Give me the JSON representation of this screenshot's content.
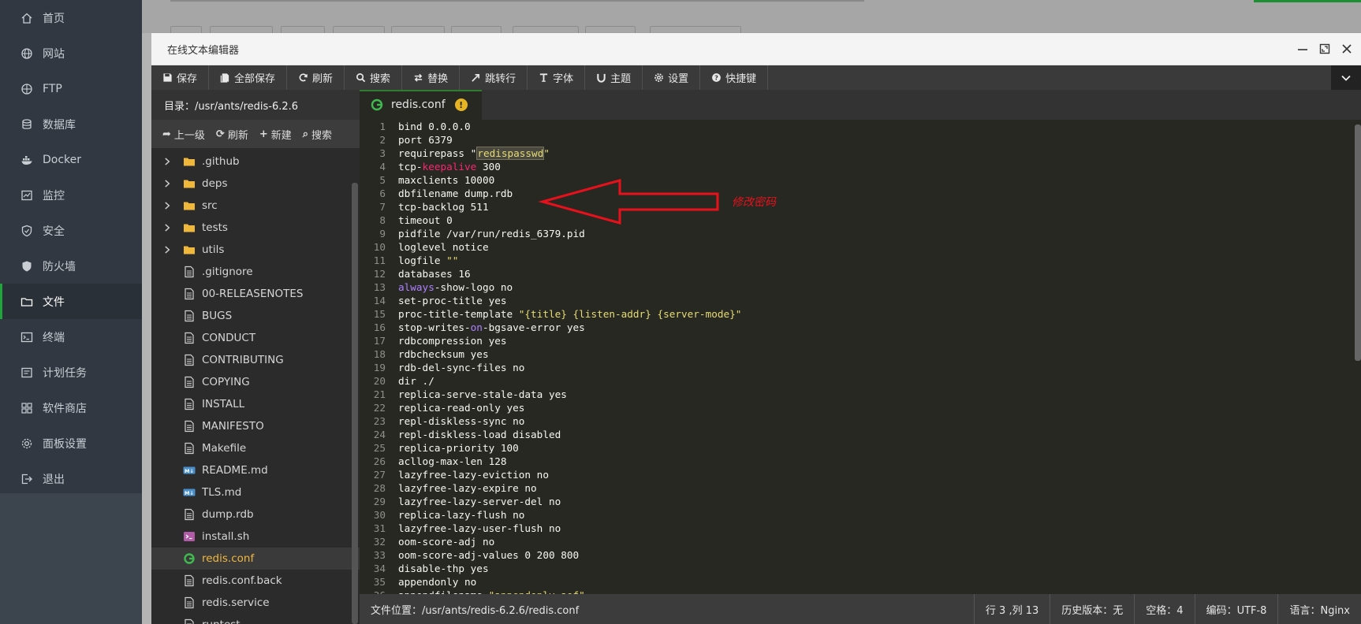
{
  "nav": {
    "items": [
      {
        "label": "首页",
        "icon": "home-icon"
      },
      {
        "label": "网站",
        "icon": "globe-icon"
      },
      {
        "label": "FTP",
        "icon": "ftp-globe-icon"
      },
      {
        "label": "数据库",
        "icon": "database-icon"
      },
      {
        "label": "Docker",
        "icon": "docker-icon"
      },
      {
        "label": "监控",
        "icon": "monitor-icon"
      },
      {
        "label": "安全",
        "icon": "shield-icon"
      },
      {
        "label": "防火墙",
        "icon": "firewall-icon"
      },
      {
        "label": "文件",
        "icon": "folder-icon"
      },
      {
        "label": "终端",
        "icon": "terminal-icon"
      },
      {
        "label": "计划任务",
        "icon": "clock-icon"
      },
      {
        "label": "软件商店",
        "icon": "apps-icon"
      },
      {
        "label": "面板设置",
        "icon": "gear-icon"
      },
      {
        "label": "退出",
        "icon": "logout-icon"
      }
    ],
    "active_index": 8
  },
  "editor": {
    "title": "在线文本编辑器",
    "toolbar": [
      {
        "label": "保存",
        "icon": "save-icon"
      },
      {
        "label": "全部保存",
        "icon": "save-all-icon"
      },
      {
        "label": "刷新",
        "icon": "refresh-icon"
      },
      {
        "label": "搜索",
        "icon": "search-icon"
      },
      {
        "label": "替换",
        "icon": "replace-icon"
      },
      {
        "label": "跳转行",
        "icon": "jump-icon"
      },
      {
        "label": "字体",
        "icon": "font-icon"
      },
      {
        "label": "主题",
        "icon": "theme-icon"
      },
      {
        "label": "设置",
        "icon": "gear-icon"
      },
      {
        "label": "快捷键",
        "icon": "help-icon"
      }
    ]
  },
  "files": {
    "directory": "目录：/usr/ants/redis-6.2.6",
    "actions": [
      {
        "label": "上一级",
        "icon": "up-icon"
      },
      {
        "label": "刷新",
        "icon": "refresh-icon"
      },
      {
        "label": "新建",
        "icon": "plus-icon"
      },
      {
        "label": "搜索",
        "icon": "search-icon"
      }
    ],
    "entries": [
      {
        "name": ".github",
        "type": "folder"
      },
      {
        "name": "deps",
        "type": "folder"
      },
      {
        "name": "src",
        "type": "folder"
      },
      {
        "name": "tests",
        "type": "folder"
      },
      {
        "name": "utils",
        "type": "folder"
      },
      {
        "name": ".gitignore",
        "type": "file"
      },
      {
        "name": "00-RELEASENOTES",
        "type": "file"
      },
      {
        "name": "BUGS",
        "type": "file"
      },
      {
        "name": "CONDUCT",
        "type": "file"
      },
      {
        "name": "CONTRIBUTING",
        "type": "file"
      },
      {
        "name": "COPYING",
        "type": "file"
      },
      {
        "name": "INSTALL",
        "type": "file"
      },
      {
        "name": "MANIFESTO",
        "type": "file"
      },
      {
        "name": "Makefile",
        "type": "file"
      },
      {
        "name": "README.md",
        "type": "markdown"
      },
      {
        "name": "TLS.md",
        "type": "markdown"
      },
      {
        "name": "dump.rdb",
        "type": "file"
      },
      {
        "name": "install.sh",
        "type": "shell"
      },
      {
        "name": "redis.conf",
        "type": "conf",
        "selected": true
      },
      {
        "name": "redis.conf.back",
        "type": "file"
      },
      {
        "name": "redis.service",
        "type": "file"
      },
      {
        "name": "runtest",
        "type": "file"
      }
    ]
  },
  "tab": {
    "filename": "redis.conf",
    "modified_marker": "!"
  },
  "code": {
    "lines": [
      "bind 0.0.0.0",
      "port 6379",
      "requirepass \"redispasswd\"",
      "tcp-keepalive 300",
      "maxclients 10000",
      "dbfilename dump.rdb",
      "tcp-backlog 511",
      "timeout 0",
      "pidfile /var/run/redis_6379.pid",
      "loglevel notice",
      "logfile \"\"",
      "databases 16",
      "always-show-logo no",
      "set-proc-title yes",
      "proc-title-template \"{title} {listen-addr} {server-mode}\"",
      "stop-writes-on-bgsave-error yes",
      "rdbcompression yes",
      "rdbchecksum yes",
      "rdb-del-sync-files no",
      "dir ./",
      "replica-serve-stale-data yes",
      "replica-read-only yes",
      "repl-diskless-sync no",
      "repl-diskless-load disabled",
      "replica-priority 100",
      "acllog-max-len 128",
      "lazyfree-lazy-eviction no",
      "lazyfree-lazy-expire no",
      "lazyfree-lazy-server-del no",
      "replica-lazy-flush no",
      "lazyfree-lazy-user-flush no",
      "oom-score-adj no",
      "oom-score-adj-values 0 200 800",
      "disable-thp yes",
      "appendonly no",
      "appendfilename \"appendonly.aof\""
    ],
    "annotation": "修改密码",
    "annotation_color": "#e8111b"
  },
  "status": {
    "path": "文件位置：/usr/ants/redis-6.2.6/redis.conf",
    "position": "行 3 ,列 13",
    "history": "历史版本：无",
    "indent": "空格：4",
    "encoding": "编码：UTF-8",
    "language": "语言：Nginx"
  },
  "colors": {
    "accent": "#20a53a",
    "sidebar": "#313841",
    "editor_bg": "#272822"
  }
}
